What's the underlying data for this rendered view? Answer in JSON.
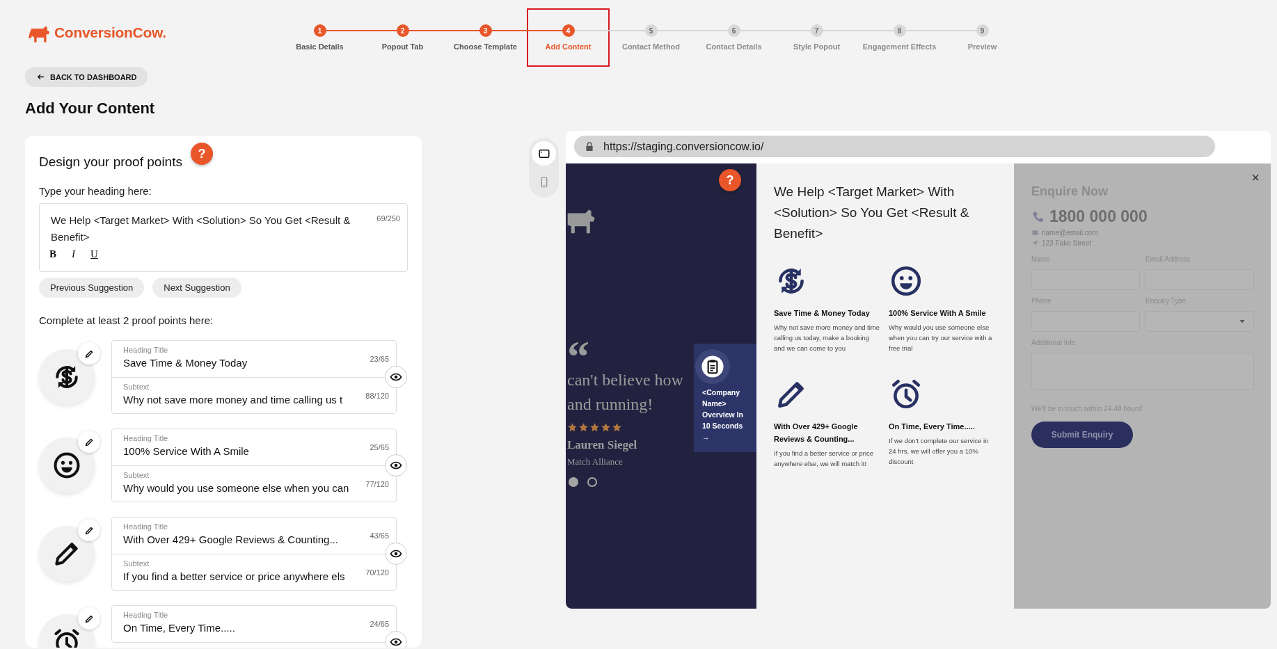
{
  "logo": {
    "text": "ConversionCow."
  },
  "steps": [
    {
      "number": "1",
      "label": "Basic Details",
      "completed": true,
      "selected": false,
      "highlighted": false
    },
    {
      "number": "2",
      "label": "Popout Tab",
      "completed": true,
      "selected": false,
      "highlighted": false
    },
    {
      "number": "3",
      "label": "Choose Template",
      "completed": true,
      "selected": false,
      "highlighted": false
    },
    {
      "number": "4",
      "label": "Add Content",
      "completed": false,
      "selected": true,
      "highlighted": true
    },
    {
      "number": "5",
      "label": "Contact Method",
      "completed": false,
      "selected": false,
      "highlighted": false
    },
    {
      "number": "6",
      "label": "Contact Details",
      "completed": false,
      "selected": false,
      "highlighted": false
    },
    {
      "number": "7",
      "label": "Style Popout",
      "completed": false,
      "selected": false,
      "highlighted": false
    },
    {
      "number": "8",
      "label": "Engagement Effects",
      "completed": false,
      "selected": false,
      "highlighted": false
    },
    {
      "number": "9",
      "label": "Preview",
      "completed": false,
      "selected": false,
      "highlighted": false
    }
  ],
  "back_button": {
    "label": "BACK TO DASHBOARD"
  },
  "page_title": "Add Your Content",
  "editor": {
    "title": "Design your proof points",
    "help": "?",
    "heading_prompt": "Type your heading here:",
    "heading_value": "We Help <Target Market> With <Solution> So You Get <Result & Benefit>",
    "heading_count": "69/250",
    "format_buttons": [
      {
        "label": "B",
        "kind": "bold"
      },
      {
        "label": "I",
        "kind": "italic"
      },
      {
        "label": "U",
        "kind": "underline"
      }
    ],
    "suggestion_buttons": [
      "Previous Suggestion",
      "Next Suggestion"
    ],
    "proof_prompt": "Complete at least 2 proof points here:",
    "proof_points": [
      {
        "kind": "money",
        "heading_label": "Heading Title",
        "heading": "Save Time & Money Today",
        "heading_count": "23/65",
        "subtext_label": "Subtext",
        "subtext": "Why not save more money and time calling us t",
        "subtext_count": "88/120"
      },
      {
        "kind": "smile",
        "heading_label": "Heading Title",
        "heading": "100% Service With A Smile",
        "heading_count": "25/65",
        "subtext_label": "Subtext",
        "subtext": "Why would you use someone else when you can",
        "subtext_count": "77/120"
      },
      {
        "kind": "reviews",
        "heading_label": "Heading Title",
        "heading": "With Over 429+ Google Reviews & Counting...",
        "heading_count": "43/65",
        "subtext_label": "Subtext",
        "subtext": "If you find a better service or price anywhere els",
        "subtext_count": "70/120"
      },
      {
        "kind": "time",
        "heading_label": "Heading Title",
        "heading": "On Time, Every Time.....",
        "heading_count": "24/65"
      }
    ]
  },
  "preview": {
    "url": "https://staging.conversioncow.io/",
    "view_toggle": [
      {
        "kind": "desktop",
        "selected": true
      },
      {
        "kind": "mobile",
        "selected": false
      }
    ],
    "help": "?",
    "testimonial": {
      "quote_mark": "“",
      "quote_lines": [
        "can't believe how",
        "and running!"
      ],
      "stars": 5,
      "name": "Lauren Siegel",
      "company": "Match Alliance",
      "dots": [
        {
          "selected": true
        },
        {
          "selected": false
        }
      ]
    },
    "side_tab": {
      "text": "<Company Name> Overview In 10 Seconds →"
    },
    "heading": "We Help <Target Market> With <Solution> So You Get <Result & Benefit>",
    "proof_points": [
      {
        "kind": "money",
        "title": "Save Time & Money Today",
        "text": "Why not save more money and time calling us today, make a booking and we can come to you"
      },
      {
        "kind": "smile",
        "title": "100% Service With A Smile",
        "text": "Why would you use someone else when you can try our service with a free trial"
      },
      {
        "kind": "reviews",
        "title": "With Over 429+ Google Reviews & Counting...",
        "text": "If you find a better service or price anywhere else, we will match it!"
      },
      {
        "kind": "time",
        "title": "On Time, Every Time.....",
        "text": "If we don't complete our service in 24 hrs, we will offer you a 10% discount"
      }
    ],
    "form": {
      "close": "×",
      "title": "Enquire Now",
      "phone": "1800 000 000",
      "email": "name@email.com",
      "address": "123 Fake Street",
      "fields": [
        {
          "label": "Name",
          "kind": "text"
        },
        {
          "label": "Email Address",
          "kind": "text"
        },
        {
          "label": "Phone",
          "kind": "text"
        },
        {
          "label": "Enquiry Type",
          "kind": "select"
        },
        {
          "label": "Additional Info",
          "kind": "textarea"
        }
      ],
      "note": "We'll be in touch within 24-48 hours!",
      "submit": "Submit Enquiry"
    }
  }
}
